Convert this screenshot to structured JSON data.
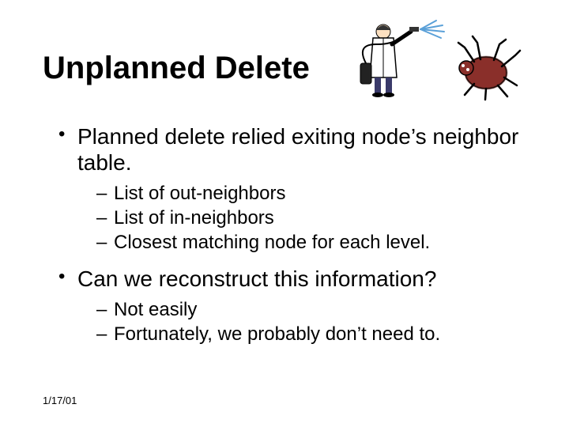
{
  "title": "Unplanned Delete",
  "date": "1/17/01",
  "bullets": [
    {
      "text": "Planned delete relied exiting node’s neighbor table.",
      "sub": [
        "List of out-neighbors",
        "List of in-neighbors",
        "Closest matching node for each level."
      ]
    },
    {
      "text": "Can we reconstruct this information?",
      "sub": [
        "Not easily",
        "Fortunately, we probably don’t need to."
      ]
    }
  ]
}
